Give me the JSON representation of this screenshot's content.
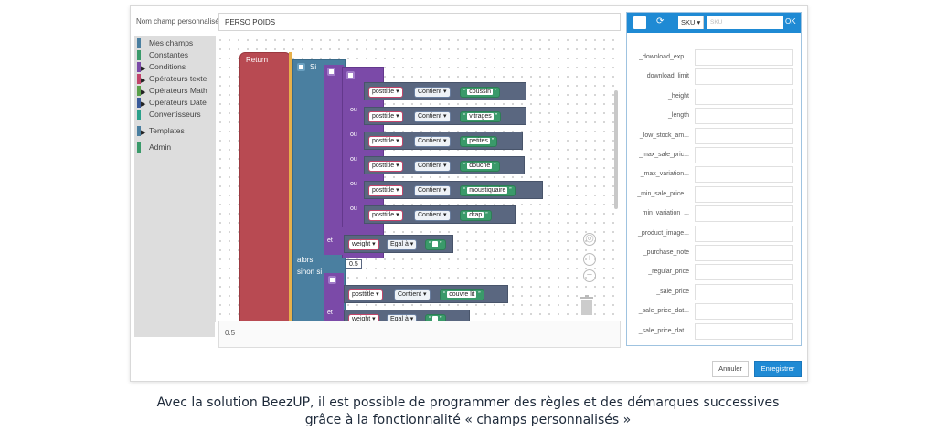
{
  "field": {
    "label": "Nom champ personnalisé",
    "value": "PERSO POIDS"
  },
  "toolbox": {
    "items": [
      {
        "label": "Mes champs",
        "color": "#4a7fa0",
        "expandable": false
      },
      {
        "label": "Constantes",
        "color": "#3a9a6a",
        "expandable": false
      },
      {
        "label": "Conditions",
        "color": "#7b4aa8",
        "expandable": true
      },
      {
        "label": "Opérateurs texte",
        "color": "#c2456a",
        "expandable": true
      },
      {
        "label": "Opérateurs Math",
        "color": "#5aa04a",
        "expandable": true
      },
      {
        "label": "Opérateurs Date",
        "color": "#3a5a9a",
        "expandable": true
      },
      {
        "label": "Convertisseurs",
        "color": "#2aa08a",
        "expandable": false
      },
      {
        "label": "Templates",
        "color": "#4a7fa0",
        "expandable": true
      },
      {
        "label": "Admin",
        "color": "#3a9a6a",
        "expandable": false
      }
    ]
  },
  "blocks": {
    "return_label": "Return",
    "si_label": "Si",
    "ou_label": "ou",
    "et_label": "et",
    "alors_label": "alors",
    "sinon_si_label": "sinon si",
    "field_name": "posttitle",
    "contains_label": "Contient",
    "equals_label": "Egal à",
    "weight_field": "weight",
    "conditions": [
      "coussin",
      "vitrages",
      "petites",
      "douche",
      "moustiquaire",
      "drap"
    ],
    "alors_value": "0.5",
    "sinon_condition": "couvre lit"
  },
  "result": {
    "value": "0.5"
  },
  "right_panel": {
    "sku_label": "SKU",
    "search_placeholder": "SKU",
    "ok_label": "OK",
    "fields": [
      "_download_exp...",
      "_download_limit",
      "_height",
      "_length",
      "_low_stock_am...",
      "_max_sale_pric...",
      "_max_variation...",
      "_min_sale_price...",
      "_min_variation_...",
      "_product_image...",
      "_purchase_note",
      "_regular_price",
      "_sale_price",
      "_sale_price_dat...",
      "_sale_price_dat..."
    ]
  },
  "buttons": {
    "cancel": "Annuler",
    "save": "Enregistrer"
  },
  "caption": {
    "line1": "Avec la solution BeezUP, il est possible de programmer des règles et des démarques successives",
    "line2": "grâce à la fonctionnalité « champs personnalisés »"
  }
}
